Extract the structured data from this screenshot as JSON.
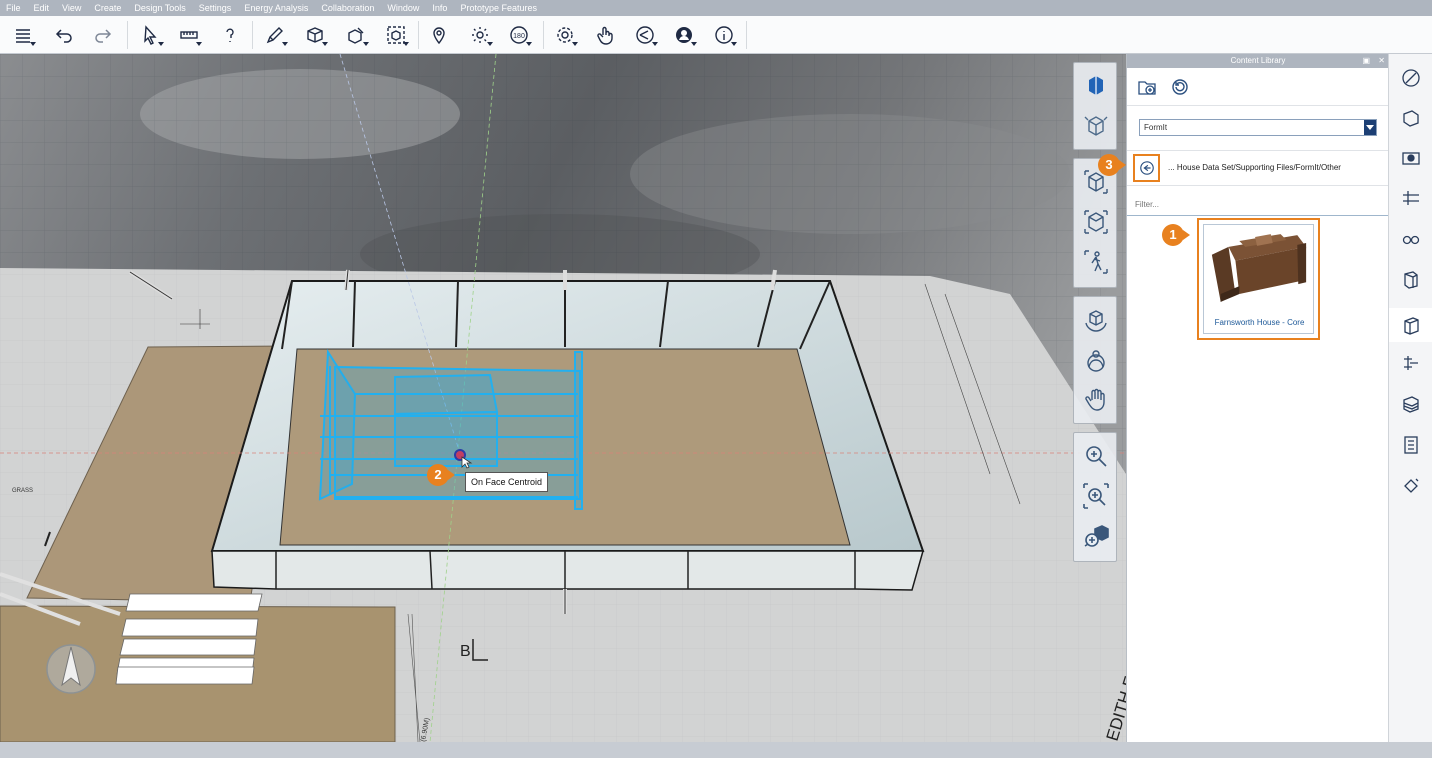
{
  "menu": {
    "items": [
      "File",
      "Edit",
      "View",
      "Create",
      "Design Tools",
      "Settings",
      "Energy Analysis",
      "Collaboration",
      "Window",
      "Info",
      "Prototype Features"
    ]
  },
  "toolbar": {
    "buttons": [
      "layers-icon",
      "undo-icon",
      "redo-icon",
      "select-icon",
      "measure-icon",
      "help-pin-icon",
      "sketch-pen-icon",
      "cube-icon",
      "cube-edit-icon",
      "group-frame-icon",
      "location-pin-icon",
      "sun-icon",
      "level-icon",
      "gear-icon",
      "hand-pointer-icon",
      "share-icon",
      "user-icon",
      "info-icon"
    ]
  },
  "viewport": {
    "tooltip": "On Face Centroid",
    "ground_label": "GRASS",
    "section_label": "B",
    "sheet_title": "EDITH FARNSWORTH HOUSE",
    "dimension_label": "(6.90M)"
  },
  "navigation": {
    "buttons": [
      "view-cube-icon",
      "orbit-icon",
      "zoom-extents-icon",
      "zoom-selected-icon",
      "walk-icon",
      "rotate-icon",
      "look-around-icon",
      "pan-hand-icon",
      "zoom-icon",
      "zoom-window-icon",
      "zoom-fit-icon"
    ]
  },
  "callouts": {
    "one": "1",
    "two": "2",
    "three": "3"
  },
  "library": {
    "title": "Content Library",
    "source": "FormIt",
    "path": "... House Data Set/Supporting Files/FormIt/Other",
    "filter_placeholder": "Filter...",
    "items": [
      {
        "label": "Farnsworth House - Core"
      }
    ]
  },
  "right_panel": {
    "icons": [
      "properties-icon",
      "materials-icon",
      "scenes-icon",
      "levels-icon",
      "visibility-icon",
      "components-icon",
      "content-library-icon",
      "layers-icon",
      "groups-icon",
      "plugins-icon",
      "paint-icon"
    ],
    "active": "content-library-icon"
  },
  "colors": {
    "accent": "#e8811f",
    "selection": "#1fa8e6",
    "link": "#1f5a99"
  }
}
